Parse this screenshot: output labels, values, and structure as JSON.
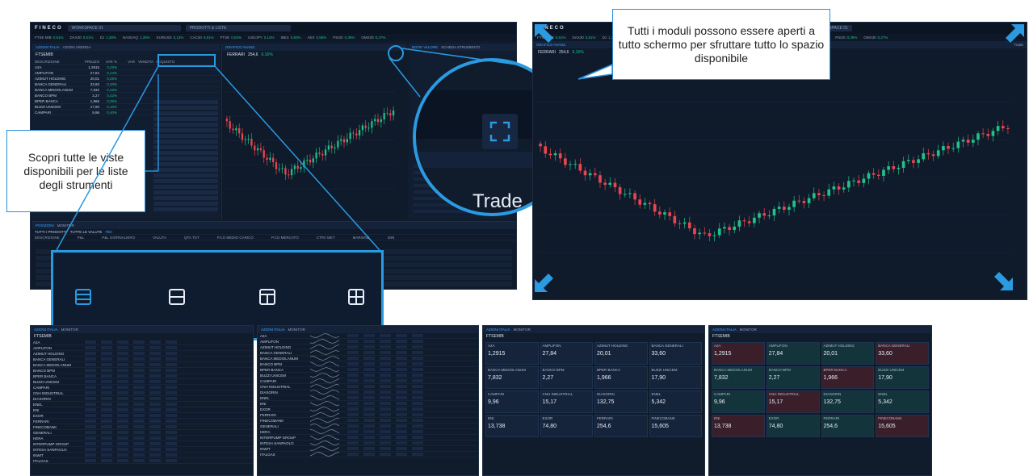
{
  "app": {
    "logo": "FINECO",
    "workspace": "WORKSPACE 01",
    "search_placeholder": "PRODOTTI & LISTE"
  },
  "ticker": [
    {
      "name": "FTSE MIB",
      "chg": "0,51%"
    },
    {
      "name": "DAX30",
      "chg": "0,51%"
    },
    {
      "name": "DJ",
      "chg": "1,38%"
    },
    {
      "name": "NASDAQ",
      "chg": "1,30%"
    },
    {
      "name": "EURUSD",
      "chg": "0,13%"
    },
    {
      "name": "CAC40",
      "chg": "0,51%"
    },
    {
      "name": "FTSE",
      "chg": "0,53%"
    },
    {
      "name": "USDJPY",
      "chg": "0,13%"
    },
    {
      "name": "IBEX",
      "chg": "0,60%"
    },
    {
      "name": "AEX",
      "chg": "0,56%"
    },
    {
      "name": "PSI20",
      "chg": "0,39%"
    },
    {
      "name": "OMX30",
      "chg": "0,27%"
    }
  ],
  "left_panel": {
    "tabs": [
      "AZIONI ITALIA",
      "AZIONI ARENDA"
    ],
    "list_title": "FTSEMIB",
    "columns": [
      "DESCRIZIONE",
      "PREZZO",
      "VAR %",
      "VAR",
      "VENDITA",
      "ACQUISTO"
    ],
    "rows": [
      {
        "name": "A2A",
        "price": "1,2915",
        "var": "0,23%"
      },
      {
        "name": "AMPLIFON",
        "price": "27,84",
        "var": "0,14%"
      },
      {
        "name": "AZIMUT HOLDING",
        "price": "20,01",
        "var": "0,25%"
      },
      {
        "name": "BANCA GENERALI",
        "price": "33,60",
        "var": "0,33%"
      },
      {
        "name": "BANCA MEDIOLANUM",
        "price": "7,832",
        "var": "0,23%"
      },
      {
        "name": "BANCO BPM",
        "price": "2,27",
        "var": "0,42%"
      },
      {
        "name": "BPER BANCA",
        "price": "1,966",
        "var": "0,25%"
      },
      {
        "name": "BUZZI UNICEM",
        "price": "17,90",
        "var": "0,10%"
      },
      {
        "name": "CAMPARI",
        "price": "9,96",
        "var": "0,40%"
      }
    ],
    "bottom_tabs": [
      "POSIZIONI",
      "MONITOR"
    ],
    "positions_header": [
      "DESCRIZIONE",
      "P&L",
      "P&L GIORNALIERO",
      "VALUTA",
      "QTA TOT",
      "P.CO MEDIO CARICO",
      "P.CO MERCATO",
      "CTRV MKT",
      "MARGINE",
      "ISIN"
    ],
    "positions_filter": [
      "TUTTI I PRODOTTI",
      "TUTTE LE VALUTE",
      "Filtri"
    ]
  },
  "chart_panel": {
    "tab": "GRAFICO AVANZ.",
    "instrument": "FERRARI",
    "price": "254,6",
    "chg": "0,16%"
  },
  "right_panel_tabs": [
    "BOOK VALORE",
    "SCHEDA STRUMENTO"
  ],
  "zoom_circle": {
    "trade_label": "Trade"
  },
  "callouts": {
    "left": "Scopri tutte le viste disponibili per le liste degli strumenti",
    "right": "Tutti i moduli possono essere aperti a tutto schermo per sfruttare tutto lo spazio disponibile"
  },
  "view_icons": [
    "list-view-icon",
    "split-horizontal-view-icon",
    "panel-view-icon",
    "grid-view-icon"
  ],
  "fullscreen": {
    "workspace": "WORKSPACE 01",
    "label": "Trade"
  },
  "bottom_lists": {
    "list_title": "FTSEMIB",
    "tabs": [
      "AZIONI ITALIA",
      "MONITOR"
    ],
    "names": [
      "A2A",
      "AMPLIFON",
      "AZIMUT HOLDING",
      "BANCA GENERALI",
      "BANCA MEDIOLANUM",
      "BANCO BPM",
      "BPER BANCA",
      "BUZZI UNICEM",
      "CAMPARI",
      "CNH INDUSTRIAL",
      "DIASORIN",
      "ENEL",
      "ENI",
      "EXOR",
      "FERRARI",
      "FINECOBANK",
      "GENERALI",
      "HERA",
      "INTERPUMP GROUP",
      "INTESA SANPAOLO",
      "INWIT",
      "ITALGAS"
    ],
    "tiles": [
      {
        "name": "A2A",
        "price": "1,2915"
      },
      {
        "name": "AMPLIFON",
        "price": "27,84"
      },
      {
        "name": "AZIMUT HOLDING",
        "price": "20,01"
      },
      {
        "name": "BANCA GENERALI",
        "price": "33,60"
      },
      {
        "name": "BANCA MEDIOLANUM",
        "price": "7,832"
      },
      {
        "name": "BANCO BPM",
        "price": "2,27"
      },
      {
        "name": "BPER BANCA",
        "price": "1,966"
      },
      {
        "name": "BUZZI UNICEM",
        "price": "17,90"
      },
      {
        "name": "CAMPARI",
        "price": "9,96"
      },
      {
        "name": "CNH INDUSTRIAL",
        "price": "15,17"
      },
      {
        "name": "DIASORIN",
        "price": "132,75"
      },
      {
        "name": "ENEL",
        "price": "5,342"
      },
      {
        "name": "ENI",
        "price": "13,738"
      },
      {
        "name": "EXOR",
        "price": "74,80"
      },
      {
        "name": "FERRARI",
        "price": "254,6"
      },
      {
        "name": "FINECOBANK",
        "price": "15,605"
      }
    ]
  },
  "colors": {
    "accent": "#2b9ae0",
    "bg": "#101b2c",
    "up": "#22c08a",
    "down": "#e8464e"
  }
}
